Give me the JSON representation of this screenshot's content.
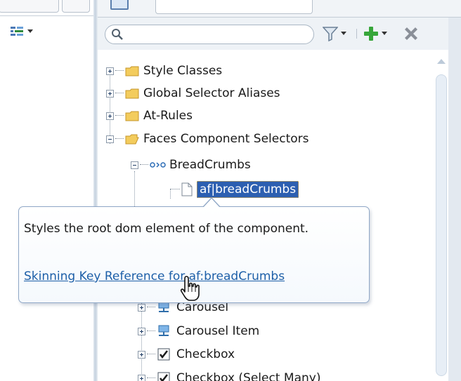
{
  "search": {
    "placeholder": "",
    "value": ""
  },
  "tree": {
    "items": [
      {
        "label": "Style Classes"
      },
      {
        "label": "Global Selector Aliases"
      },
      {
        "label": "At-Rules"
      },
      {
        "label": "Faces Component Selectors"
      },
      {
        "label": "BreadCrumbs"
      },
      {
        "label": "af|breadCrumbs"
      },
      {
        "label": "Carousel"
      },
      {
        "label": "Carousel Item"
      },
      {
        "label": "Checkbox"
      },
      {
        "label": "Checkbox (Select Many)"
      }
    ]
  },
  "tooltip": {
    "description": "Styles the root dom element of the component.",
    "link": "Skinning Key Reference for af:breadCrumbs"
  },
  "icons": {
    "search": "search-icon",
    "filter": "filter-icon",
    "add": "add-icon",
    "delete": "delete-icon",
    "folder": "folder-icon",
    "selector": "selector-icon",
    "page": "page-icon",
    "carousel": "carousel-icon",
    "checkbox": "checkbox-icon",
    "cursor": "hand-cursor-icon"
  },
  "colors": {
    "selection": "#2c5fb1",
    "link": "#1d5fa8",
    "add_icon": "#37a63a",
    "delete_icon": "#8a8f98"
  }
}
